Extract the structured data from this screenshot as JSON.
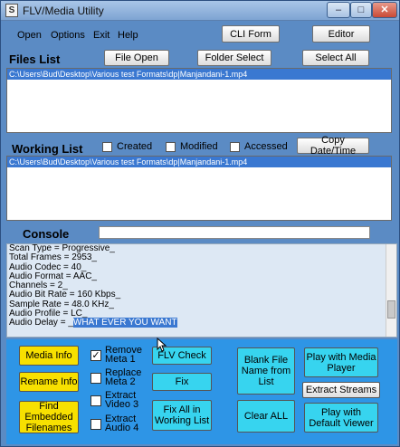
{
  "window": {
    "title": "FLV/Media Utility",
    "app_icon": "S",
    "caption": {
      "min": "–",
      "max": "□",
      "close": "✕"
    }
  },
  "menu": [
    "Open",
    "Options",
    "Exit",
    "Help"
  ],
  "top_buttons": {
    "cli_form": "CLI Form",
    "editor": "Editor"
  },
  "files_list": {
    "label": "Files List",
    "file_open": "File Open",
    "folder_select": "Folder Select",
    "select_all": "Select All",
    "items": [
      "C:\\Users\\Bud\\Desktop\\Various test Formats\\dp|Manjandani-1.mp4"
    ]
  },
  "working_list": {
    "label": "Working List",
    "created": "Created",
    "modified": "Modified",
    "accessed": "Accessed",
    "copy_date_time": "Copy Date/Time",
    "items": [
      "C:\\Users\\Bud\\Desktop\\Various test Formats\\dp|Manjandani-1.mp4"
    ]
  },
  "console": {
    "label": "Console",
    "lines": [
      "Scan Type = Progressive_",
      "Total Frames = 2953_",
      "Audio Codec = 40_",
      "Audio Format = AAC_",
      "Channels = 2_",
      "Audio Bit Rate = 160 Kbps_",
      "Sample Rate = 48.0 KHz_",
      "Audio Profile = LC_"
    ],
    "last_line_prefix": "Audio Delay = _",
    "last_line_selected": "WHAT EVER YOU WANT"
  },
  "panel": {
    "media_info": "Media Info",
    "rename_info": "Rename Info",
    "find_embedded": "Find Embedded Filenames",
    "remove_meta1": "Remove Meta 1",
    "remove_meta1_checked": "✓",
    "replace_meta2": "Replace Meta 2",
    "extract_video3": "Extract Video 3",
    "extract_audio4": "Extract Audio 4",
    "flv_check": "FLV Check",
    "fix": "Fix",
    "fix_all": "Fix All in Working List",
    "blank_file_name": "Blank File Name from List",
    "clear_all": "Clear ALL",
    "play_media_player": "Play with Media Player",
    "extract_streams": "Extract Streams",
    "play_default_viewer": "Play with Default Viewer"
  }
}
